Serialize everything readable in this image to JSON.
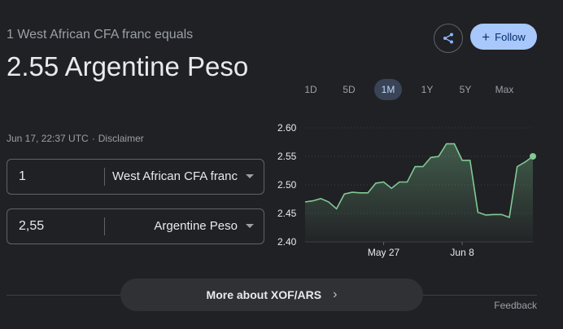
{
  "header": {
    "subtitle": "1 West African CFA franc equals",
    "value": "2.55 Argentine Peso",
    "timestamp": "Jun 17, 22:37 UTC",
    "separator": "·",
    "disclaimer": "Disclaimer"
  },
  "actions": {
    "share_icon": "share-icon",
    "follow_label": "Follow",
    "follow_icon": "+"
  },
  "converter": {
    "from": {
      "amount": "1",
      "currency": "West African CFA franc"
    },
    "to": {
      "amount": "2,55",
      "currency": "Argentine Peso"
    }
  },
  "ranges": [
    {
      "label": "1D",
      "active": false
    },
    {
      "label": "5D",
      "active": false
    },
    {
      "label": "1M",
      "active": true
    },
    {
      "label": "1Y",
      "active": false
    },
    {
      "label": "5Y",
      "active": false
    },
    {
      "label": "Max",
      "active": false
    }
  ],
  "chart_data": {
    "type": "area",
    "color": "#81c995",
    "ylim": [
      2.4,
      2.6
    ],
    "yticks": [
      "2.60",
      "2.55",
      "2.50",
      "2.45",
      "2.40"
    ],
    "xtick_labels": [
      {
        "label": "May 27",
        "index": 10
      },
      {
        "label": "Jun 8",
        "index": 20
      }
    ],
    "values": [
      2.47,
      2.472,
      2.476,
      2.47,
      2.458,
      2.484,
      2.487,
      2.486,
      2.486,
      2.503,
      2.505,
      2.494,
      2.505,
      2.505,
      2.532,
      2.532,
      2.548,
      2.55,
      2.572,
      2.572,
      2.543,
      2.543,
      2.452,
      2.447,
      2.448,
      2.448,
      2.443,
      2.532,
      2.54,
      2.55
    ]
  },
  "footer": {
    "more_label": "More about XOF/ARS",
    "more_chevron": "›",
    "feedback": "Feedback"
  }
}
